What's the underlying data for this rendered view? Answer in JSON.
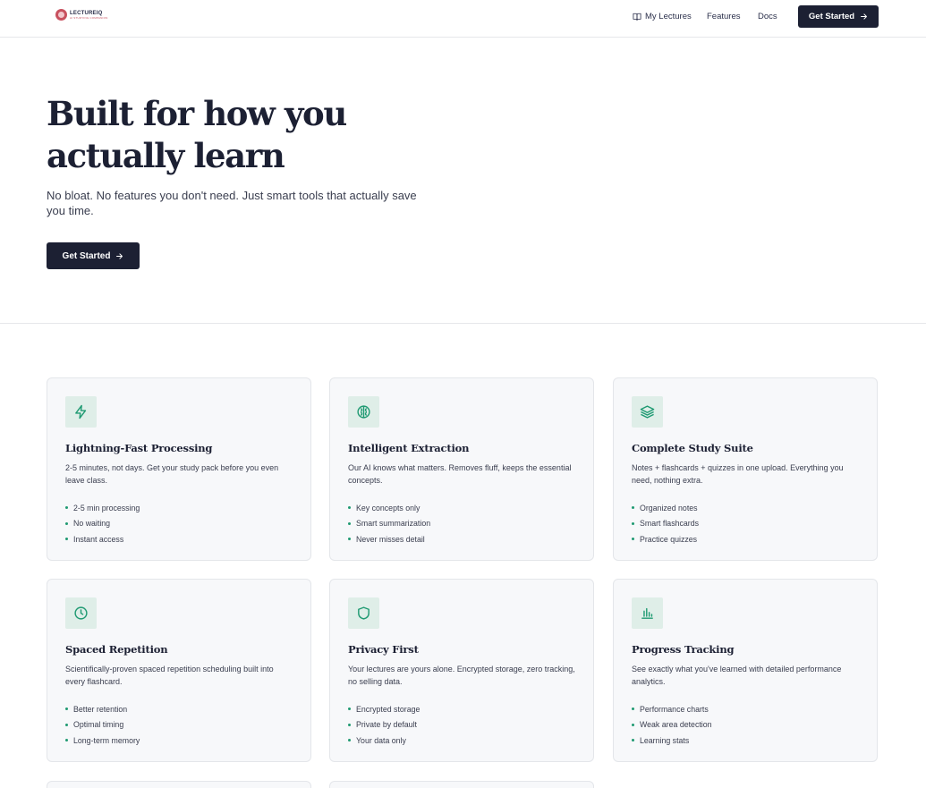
{
  "brand": {
    "name": "LECTUREIQ",
    "tagline": "AI STUDYING COMPANION",
    "logo_color": "#c8515f"
  },
  "nav": {
    "links": [
      {
        "label": "My Lectures",
        "icon": "book-open-icon"
      },
      {
        "label": "Features"
      },
      {
        "label": "Docs"
      }
    ],
    "cta_label": "Get Started"
  },
  "hero": {
    "title": "Built for how you actually learn",
    "subtitle": "No bloat. No features you don't need. Just smart tools that actually save you time.",
    "cta_label": "Get Started"
  },
  "colors": {
    "primary": "#1c2033",
    "accent": "#1f9a72",
    "icon_bg": "#dfeee8",
    "card_bg": "#f7f8fa"
  },
  "features": [
    {
      "icon": "lightning-icon",
      "title": "Lightning-Fast Processing",
      "description": "2-5 minutes, not days. Get your study pack before you even leave class.",
      "bullets": [
        "2-5 min processing",
        "No waiting",
        "Instant access"
      ]
    },
    {
      "icon": "brain-icon",
      "title": "Intelligent Extraction",
      "description": "Our AI knows what matters. Removes fluff, keeps the essential concepts.",
      "bullets": [
        "Key concepts only",
        "Smart summarization",
        "Never misses detail"
      ]
    },
    {
      "icon": "layers-icon",
      "title": "Complete Study Suite",
      "description": "Notes + flashcards + quizzes in one upload. Everything you need, nothing extra.",
      "bullets": [
        "Organized notes",
        "Smart flashcards",
        "Practice quizzes"
      ]
    },
    {
      "icon": "clock-icon",
      "title": "Spaced Repetition",
      "description": "Scientifically-proven spaced repetition scheduling built into every flashcard.",
      "bullets": [
        "Better retention",
        "Optimal timing",
        "Long-term memory"
      ]
    },
    {
      "icon": "shield-icon",
      "title": "Privacy First",
      "description": "Your lectures are yours alone. Encrypted storage, zero tracking, no selling data.",
      "bullets": [
        "Encrypted storage",
        "Private by default",
        "Your data only"
      ]
    },
    {
      "icon": "bar-chart-icon",
      "title": "Progress Tracking",
      "description": "See exactly what you've learned with detailed performance analytics.",
      "bullets": [
        "Performance charts",
        "Weak area detection",
        "Learning stats"
      ]
    }
  ]
}
